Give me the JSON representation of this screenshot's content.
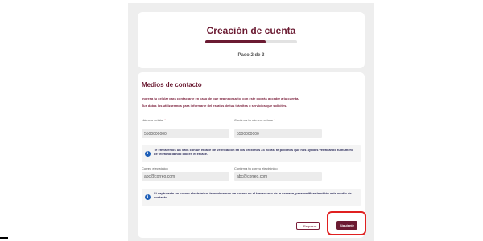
{
  "header": {
    "title": "Creación de cuenta",
    "step": "Paso 2 de 3",
    "progress": 0.66
  },
  "section": {
    "title": "Medios de contacto",
    "intro_1": "Ingresa tu celular para contactarte en caso de que sea necesario, con éste podrás acceder a tu cuenta.",
    "intro_2": "Tus datos los utilizaremos para informarte del estatus de tus trámites o servicios que solicites."
  },
  "fields": {
    "phone_label": "Número celular",
    "phone_value": "5500000000",
    "phone_confirm_label": "Confirma tu número celular",
    "phone_confirm_value": "5500000000",
    "email_label": "Correo electrónico",
    "email_placeholder": "abc@correo.com",
    "email_confirm_label": "Confirma tu correo electrónico",
    "email_confirm_placeholder": "abc@correo.com",
    "required_mark": "*"
  },
  "info": {
    "sms_notice": "Te enviaremos un SMS con un enlace de verificación en los próximos 24 horas, te pedimos que nos ayudes verificando tu número de teléfono dando clic en el enlace.",
    "email_notice": "Si capturaste un correo electrónico, te enviaremos un correo en el transcurso de la semana, para verificar también este medio de contacto.",
    "icon_glyph": "i"
  },
  "buttons": {
    "back_label": "← Regresar",
    "next_label": "Siguiente"
  },
  "colors": {
    "brand": "#6b1b32",
    "info_icon": "#1e5fb8",
    "highlight": "#e02020"
  }
}
